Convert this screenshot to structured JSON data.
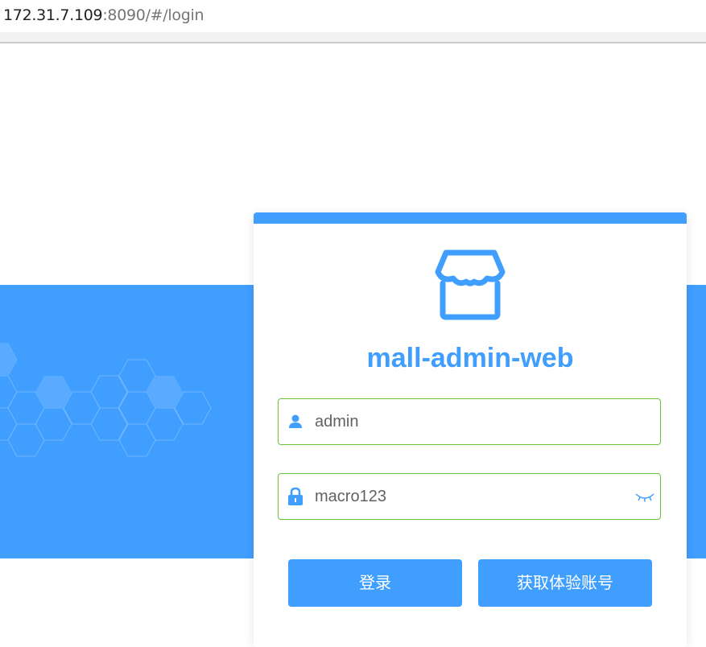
{
  "browser": {
    "url_host": "172.31.7.109",
    "url_rest": ":8090/#/login"
  },
  "login": {
    "title": "mall-admin-web",
    "username": {
      "value": "admin",
      "icon": "user-icon"
    },
    "password": {
      "value": "macro123",
      "icon": "lock-icon",
      "toggle_icon": "eye-closed-icon"
    },
    "login_button": "登录",
    "trial_button": "获取体验账号",
    "logo_icon": "storefront-icon"
  },
  "colors": {
    "primary": "#409eff",
    "valid_border": "#67c23a"
  }
}
